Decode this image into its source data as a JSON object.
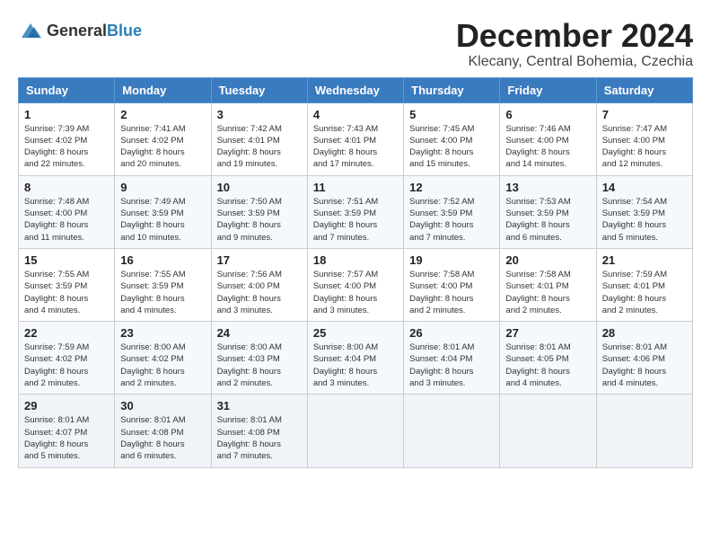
{
  "header": {
    "logo_general": "General",
    "logo_blue": "Blue",
    "month_title": "December 2024",
    "subtitle": "Klecany, Central Bohemia, Czechia"
  },
  "weekdays": [
    "Sunday",
    "Monday",
    "Tuesday",
    "Wednesday",
    "Thursday",
    "Friday",
    "Saturday"
  ],
  "weeks": [
    [
      {
        "day": "1",
        "info": "Sunrise: 7:39 AM\nSunset: 4:02 PM\nDaylight: 8 hours\nand 22 minutes."
      },
      {
        "day": "2",
        "info": "Sunrise: 7:41 AM\nSunset: 4:02 PM\nDaylight: 8 hours\nand 20 minutes."
      },
      {
        "day": "3",
        "info": "Sunrise: 7:42 AM\nSunset: 4:01 PM\nDaylight: 8 hours\nand 19 minutes."
      },
      {
        "day": "4",
        "info": "Sunrise: 7:43 AM\nSunset: 4:01 PM\nDaylight: 8 hours\nand 17 minutes."
      },
      {
        "day": "5",
        "info": "Sunrise: 7:45 AM\nSunset: 4:00 PM\nDaylight: 8 hours\nand 15 minutes."
      },
      {
        "day": "6",
        "info": "Sunrise: 7:46 AM\nSunset: 4:00 PM\nDaylight: 8 hours\nand 14 minutes."
      },
      {
        "day": "7",
        "info": "Sunrise: 7:47 AM\nSunset: 4:00 PM\nDaylight: 8 hours\nand 12 minutes."
      }
    ],
    [
      {
        "day": "8",
        "info": "Sunrise: 7:48 AM\nSunset: 4:00 PM\nDaylight: 8 hours\nand 11 minutes."
      },
      {
        "day": "9",
        "info": "Sunrise: 7:49 AM\nSunset: 3:59 PM\nDaylight: 8 hours\nand 10 minutes."
      },
      {
        "day": "10",
        "info": "Sunrise: 7:50 AM\nSunset: 3:59 PM\nDaylight: 8 hours\nand 9 minutes."
      },
      {
        "day": "11",
        "info": "Sunrise: 7:51 AM\nSunset: 3:59 PM\nDaylight: 8 hours\nand 7 minutes."
      },
      {
        "day": "12",
        "info": "Sunrise: 7:52 AM\nSunset: 3:59 PM\nDaylight: 8 hours\nand 7 minutes."
      },
      {
        "day": "13",
        "info": "Sunrise: 7:53 AM\nSunset: 3:59 PM\nDaylight: 8 hours\nand 6 minutes."
      },
      {
        "day": "14",
        "info": "Sunrise: 7:54 AM\nSunset: 3:59 PM\nDaylight: 8 hours\nand 5 minutes."
      }
    ],
    [
      {
        "day": "15",
        "info": "Sunrise: 7:55 AM\nSunset: 3:59 PM\nDaylight: 8 hours\nand 4 minutes."
      },
      {
        "day": "16",
        "info": "Sunrise: 7:55 AM\nSunset: 3:59 PM\nDaylight: 8 hours\nand 4 minutes."
      },
      {
        "day": "17",
        "info": "Sunrise: 7:56 AM\nSunset: 4:00 PM\nDaylight: 8 hours\nand 3 minutes."
      },
      {
        "day": "18",
        "info": "Sunrise: 7:57 AM\nSunset: 4:00 PM\nDaylight: 8 hours\nand 3 minutes."
      },
      {
        "day": "19",
        "info": "Sunrise: 7:58 AM\nSunset: 4:00 PM\nDaylight: 8 hours\nand 2 minutes."
      },
      {
        "day": "20",
        "info": "Sunrise: 7:58 AM\nSunset: 4:01 PM\nDaylight: 8 hours\nand 2 minutes."
      },
      {
        "day": "21",
        "info": "Sunrise: 7:59 AM\nSunset: 4:01 PM\nDaylight: 8 hours\nand 2 minutes."
      }
    ],
    [
      {
        "day": "22",
        "info": "Sunrise: 7:59 AM\nSunset: 4:02 PM\nDaylight: 8 hours\nand 2 minutes."
      },
      {
        "day": "23",
        "info": "Sunrise: 8:00 AM\nSunset: 4:02 PM\nDaylight: 8 hours\nand 2 minutes."
      },
      {
        "day": "24",
        "info": "Sunrise: 8:00 AM\nSunset: 4:03 PM\nDaylight: 8 hours\nand 2 minutes."
      },
      {
        "day": "25",
        "info": "Sunrise: 8:00 AM\nSunset: 4:04 PM\nDaylight: 8 hours\nand 3 minutes."
      },
      {
        "day": "26",
        "info": "Sunrise: 8:01 AM\nSunset: 4:04 PM\nDaylight: 8 hours\nand 3 minutes."
      },
      {
        "day": "27",
        "info": "Sunrise: 8:01 AM\nSunset: 4:05 PM\nDaylight: 8 hours\nand 4 minutes."
      },
      {
        "day": "28",
        "info": "Sunrise: 8:01 AM\nSunset: 4:06 PM\nDaylight: 8 hours\nand 4 minutes."
      }
    ],
    [
      {
        "day": "29",
        "info": "Sunrise: 8:01 AM\nSunset: 4:07 PM\nDaylight: 8 hours\nand 5 minutes."
      },
      {
        "day": "30",
        "info": "Sunrise: 8:01 AM\nSunset: 4:08 PM\nDaylight: 8 hours\nand 6 minutes."
      },
      {
        "day": "31",
        "info": "Sunrise: 8:01 AM\nSunset: 4:08 PM\nDaylight: 8 hours\nand 7 minutes."
      },
      {
        "day": "",
        "info": ""
      },
      {
        "day": "",
        "info": ""
      },
      {
        "day": "",
        "info": ""
      },
      {
        "day": "",
        "info": ""
      }
    ]
  ]
}
